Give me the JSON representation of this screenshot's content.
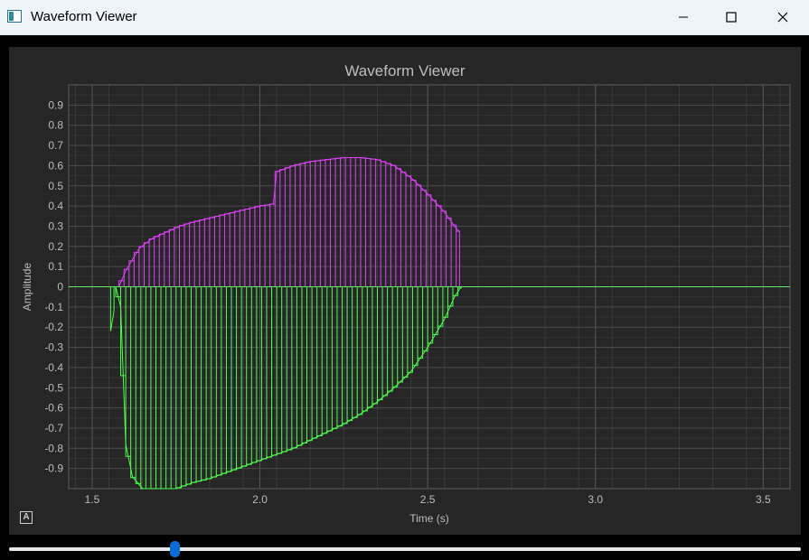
{
  "window": {
    "title": "Waveform Viewer"
  },
  "chart_data": {
    "type": "line",
    "title": "Waveform Viewer",
    "xlabel": "Time (s)",
    "ylabel": "Amplitude",
    "xlim": [
      1.43,
      3.58
    ],
    "ylim": [
      -1.0,
      1.0
    ],
    "xticks": [
      "1.5",
      "2.0",
      "2.5",
      "3.0",
      "3.5"
    ],
    "yticks": [
      "0.9",
      "0.8",
      "0.7",
      "0.6",
      "0.5",
      "0.4",
      "0.3",
      "0.2",
      "0.1",
      "0",
      "-0.1",
      "-0.2",
      "-0.3",
      "-0.4",
      "-0.5",
      "-0.6",
      "-0.7",
      "-0.8",
      "-0.9"
    ],
    "grid": true,
    "series": [
      {
        "color": "#e040fb",
        "x": [
          1.58,
          1.6,
          1.64,
          1.68,
          1.72,
          1.76,
          1.8,
          1.85,
          1.9,
          1.95,
          2.0,
          2.04,
          2.05,
          2.1,
          2.15,
          2.2,
          2.25,
          2.3,
          2.35,
          2.4,
          2.45,
          2.5,
          2.55,
          2.58,
          2.595
        ],
        "y": [
          0.0,
          0.08,
          0.19,
          0.24,
          0.27,
          0.3,
          0.32,
          0.34,
          0.36,
          0.38,
          0.4,
          0.41,
          0.57,
          0.6,
          0.62,
          0.63,
          0.64,
          0.64,
          0.63,
          0.6,
          0.54,
          0.46,
          0.37,
          0.3,
          0.27
        ]
      },
      {
        "color": "#4cff4c",
        "x": [
          1.57,
          1.585,
          1.6,
          1.62,
          1.65,
          1.7,
          1.75,
          1.8,
          1.85,
          1.9,
          1.95,
          2.0,
          2.05,
          2.1,
          2.15,
          2.2,
          2.25,
          2.3,
          2.35,
          2.4,
          2.45,
          2.5,
          2.55,
          2.58,
          2.6
        ],
        "y": [
          0.0,
          -0.1,
          -0.78,
          -0.94,
          -1.0,
          -1.0,
          -1.0,
          -0.97,
          -0.95,
          -0.92,
          -0.89,
          -0.86,
          -0.83,
          -0.8,
          -0.76,
          -0.72,
          -0.68,
          -0.63,
          -0.57,
          -0.5,
          -0.42,
          -0.3,
          -0.16,
          -0.05,
          0.0
        ]
      }
    ],
    "extra_dip": {
      "x": [
        1.555,
        1.565
      ],
      "y": [
        0.0,
        -0.22
      ]
    },
    "zero_line_color": "#66ee66",
    "sample_step": 0.015
  },
  "slider": {
    "value_fraction": 0.21
  }
}
